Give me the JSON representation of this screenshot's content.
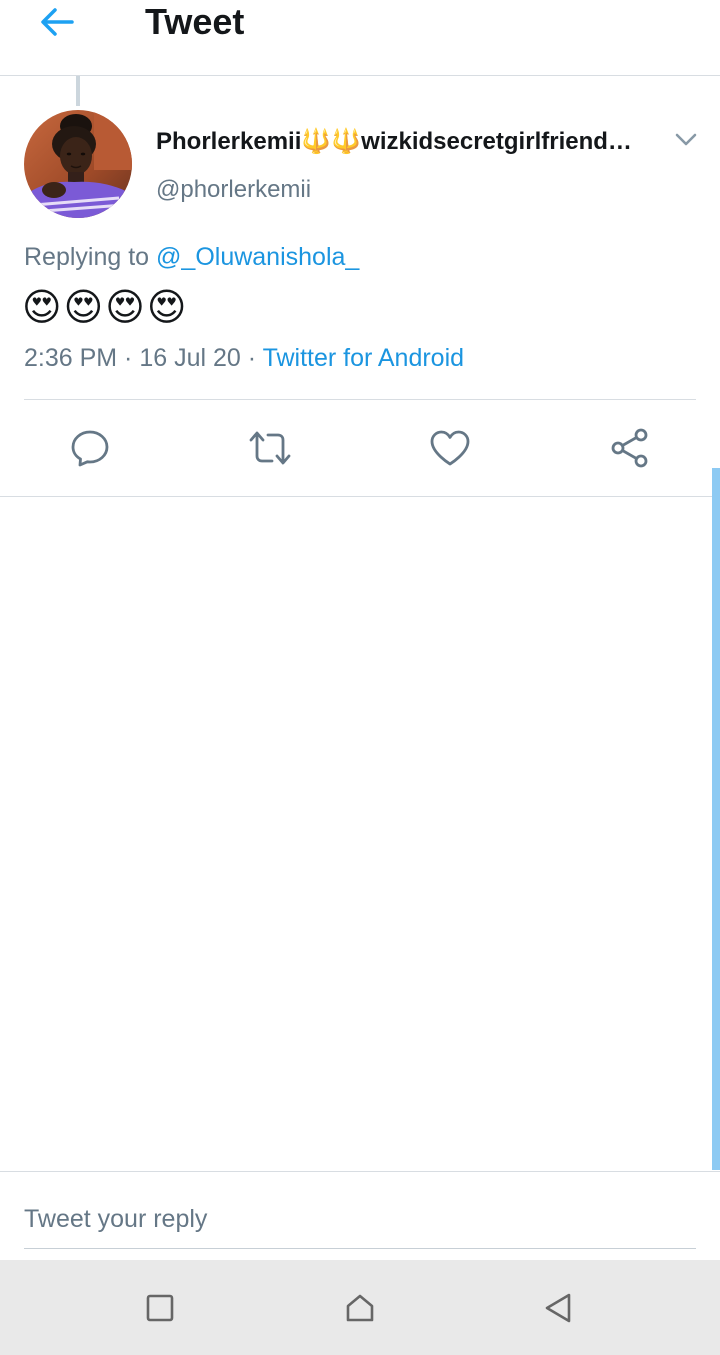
{
  "header": {
    "title": "Tweet",
    "back_icon": "arrow-left-icon"
  },
  "tweet": {
    "display_name": "Phorlerkemii🔱🔱wizkidsecretgirlfriend…",
    "handle": "@phorlerkemii",
    "replying_prefix": "Replying to ",
    "replying_to": "@_Oluwanishola_",
    "text": "😍😍😍😍",
    "time": "2:36 PM",
    "date": "16 Jul 20",
    "separator": " · ",
    "source": "Twitter for Android"
  },
  "actions": [
    {
      "name": "reply",
      "icon": "reply-bubble-icon"
    },
    {
      "name": "retweet",
      "icon": "retweet-icon"
    },
    {
      "name": "like",
      "icon": "heart-icon"
    },
    {
      "name": "share",
      "icon": "share-icon"
    }
  ],
  "reply_box": {
    "placeholder": "Tweet your reply"
  },
  "system_nav": {
    "recents_icon": "square-icon",
    "home_icon": "home-icon",
    "back_icon": "triangle-back-icon"
  },
  "colors": {
    "accent": "#1DA1F2",
    "link": "#1B95E0",
    "secondary_text": "#657786",
    "primary_text": "#14171A",
    "divider": "#D8DDE2",
    "icon_gray": "#657786",
    "nav_bar_bg": "#E9E9E9",
    "scrollbar": "#8DCAF3"
  }
}
